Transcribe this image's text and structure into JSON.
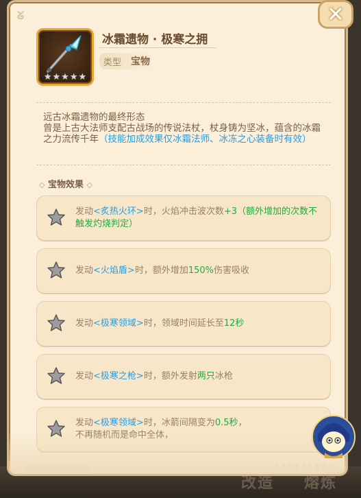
{
  "item": {
    "title": "冰霜遗物 · 极寒之拥",
    "type_label": "类型",
    "type_value": "宝物",
    "stars": 5,
    "icon": "ice-spear-icon"
  },
  "description": {
    "line1": "远古冰霜遗物的最终形态",
    "line2_prefix": "曾是上古大法师支配古战场的传说法杖，杖身铸为坚冰，蕴含的冰霜之力流传千年",
    "line2_highlight": "（技能加成效果仅冰霜法师、冰冻之心装备时有效）"
  },
  "section": {
    "label": "宝物效果"
  },
  "effects": [
    {
      "a": "发动",
      "skill": "<炙热火环>",
      "b": "时，火焰冲击波次数",
      "value": "+3（额外增加的次数不触发灼烧判定）",
      "c": ""
    },
    {
      "a": "发动",
      "skill": "<火焰盾>",
      "b": "时，额外增加",
      "value": "150%",
      "c": "伤害吸收"
    },
    {
      "a": "发动",
      "skill": "<极寒领域>",
      "b": "时，领域时间延长至",
      "value": "12秒",
      "c": ""
    },
    {
      "a": "发动",
      "skill": "<极寒之枪>",
      "b": "时，额外发射",
      "value": "两只",
      "c": "冰枪"
    },
    {
      "a": "发动",
      "skill": "<极寒领域>",
      "b": "时，冰箭间隔变为",
      "value": "0.5秒",
      "c": "，",
      "line2": "不再随机而是命中全体，"
    }
  ],
  "bottom_buttons": {
    "left": "改造",
    "right": "熔炼"
  },
  "colors": {
    "panel_bg": "#fbefd9",
    "skill_blue": "#2a9ee2",
    "value_green": "#1fae3d",
    "border_gold": "#e7a738"
  }
}
